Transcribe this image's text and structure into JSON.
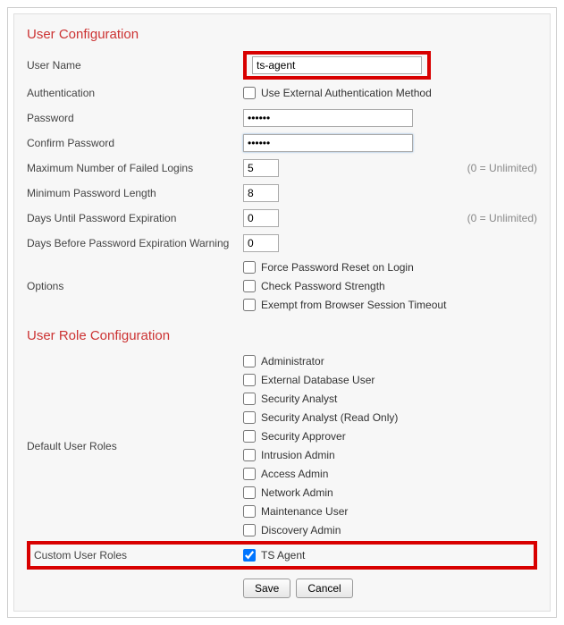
{
  "userConfig": {
    "title": "User Configuration",
    "userName": {
      "label": "User Name",
      "value": "ts-agent"
    },
    "authentication": {
      "label": "Authentication",
      "checkboxLabel": "Use External Authentication Method",
      "checked": false
    },
    "password": {
      "label": "Password",
      "value": "••••••"
    },
    "confirmPassword": {
      "label": "Confirm Password",
      "value": "••••••"
    },
    "maxFailedLogins": {
      "label": "Maximum Number of Failed Logins",
      "value": "5",
      "hint": "(0 = Unlimited)"
    },
    "minPasswordLength": {
      "label": "Minimum Password Length",
      "value": "8"
    },
    "daysUntilExpire": {
      "label": "Days Until Password Expiration",
      "value": "0",
      "hint": "(0 = Unlimited)"
    },
    "daysBeforeWarning": {
      "label": "Days Before Password Expiration Warning",
      "value": "0"
    },
    "options": {
      "label": "Options",
      "items": [
        {
          "label": "Force Password Reset on Login",
          "checked": false
        },
        {
          "label": "Check Password Strength",
          "checked": false
        },
        {
          "label": "Exempt from Browser Session Timeout",
          "checked": false
        }
      ]
    }
  },
  "roleConfig": {
    "title": "User Role Configuration",
    "defaultRoles": {
      "label": "Default User Roles",
      "items": [
        {
          "label": "Administrator",
          "checked": false
        },
        {
          "label": "External Database User",
          "checked": false
        },
        {
          "label": "Security Analyst",
          "checked": false
        },
        {
          "label": "Security Analyst (Read Only)",
          "checked": false
        },
        {
          "label": "Security Approver",
          "checked": false
        },
        {
          "label": "Intrusion Admin",
          "checked": false
        },
        {
          "label": "Access Admin",
          "checked": false
        },
        {
          "label": "Network Admin",
          "checked": false
        },
        {
          "label": "Maintenance User",
          "checked": false
        },
        {
          "label": "Discovery Admin",
          "checked": false
        }
      ]
    },
    "customRoles": {
      "label": "Custom User Roles",
      "items": [
        {
          "label": "TS Agent",
          "checked": true
        }
      ]
    }
  },
  "buttons": {
    "save": "Save",
    "cancel": "Cancel"
  }
}
